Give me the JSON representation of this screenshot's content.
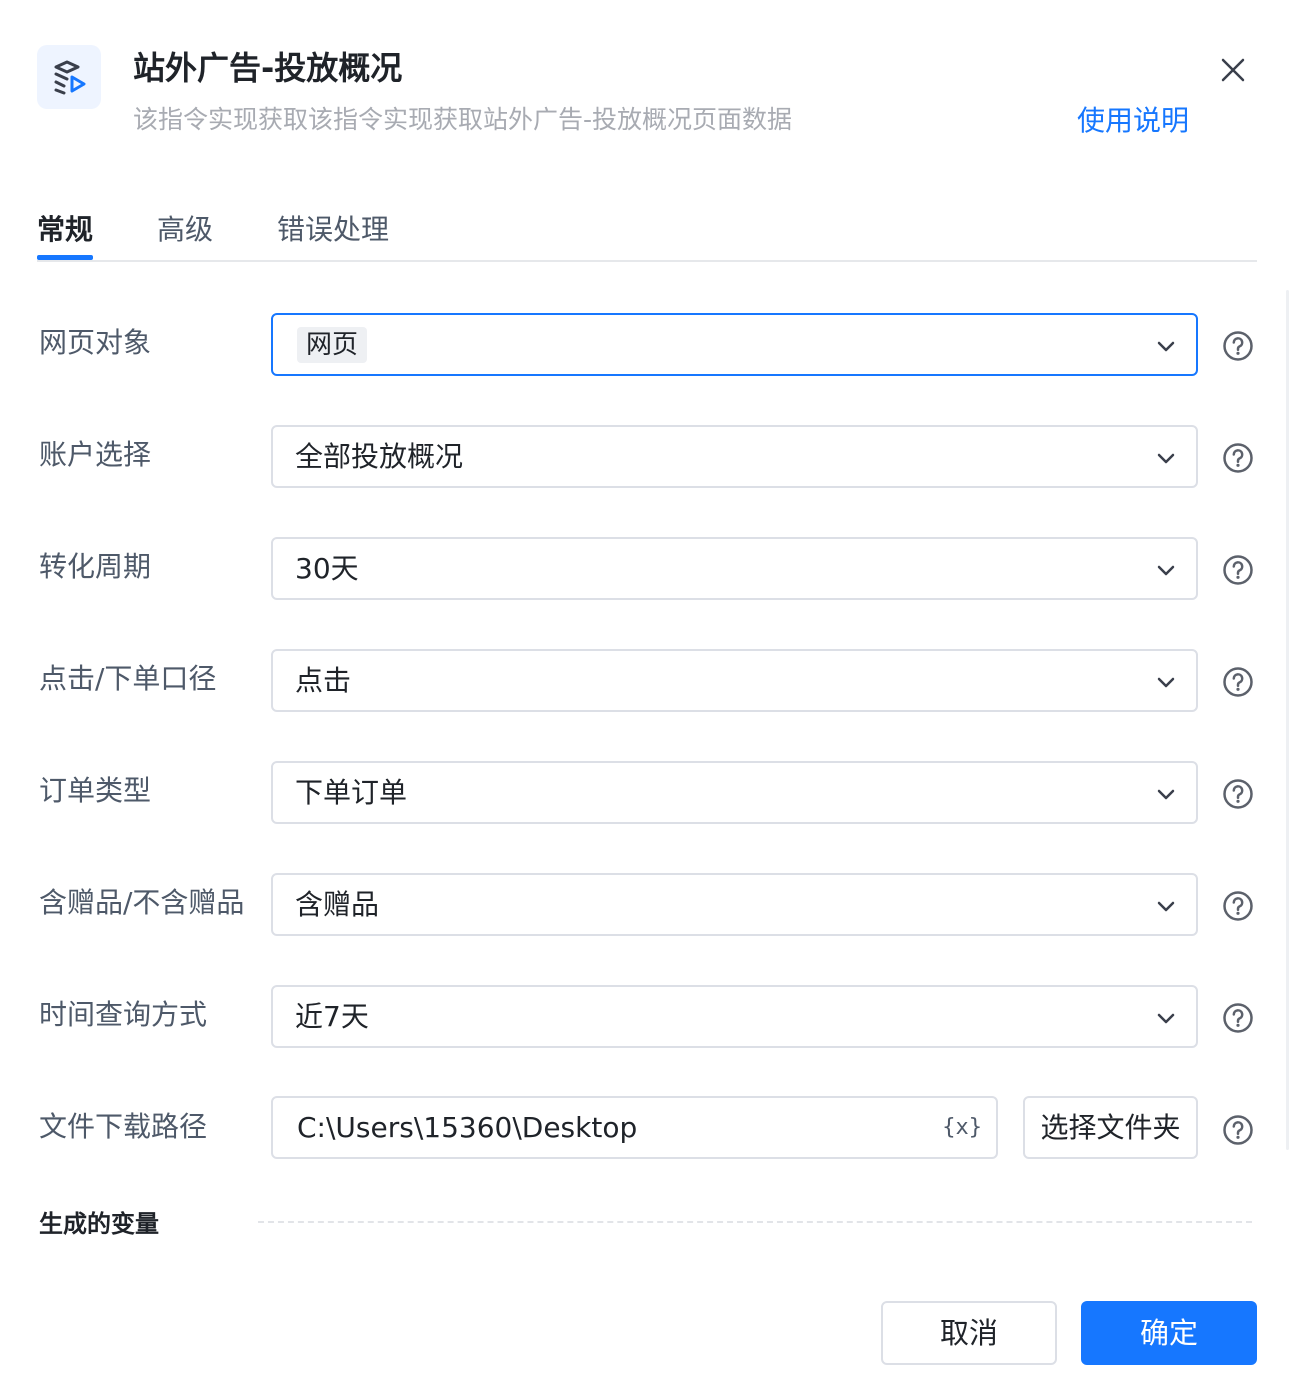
{
  "header": {
    "title": "站外广告-投放概况",
    "subtitle": "该指令实现获取该指令实现获取站外广告-投放概况页面数据",
    "help_link": "使用说明",
    "accent": "#1677ff"
  },
  "tabs": [
    {
      "label": "常规",
      "active": true
    },
    {
      "label": "高级",
      "active": false
    },
    {
      "label": "错误处理",
      "active": false
    }
  ],
  "form": {
    "web_object": {
      "label": "网页对象",
      "value": "网页"
    },
    "account": {
      "label": "账户选择",
      "value": "全部投放概况"
    },
    "conversion_period": {
      "label": "转化周期",
      "value": "30天"
    },
    "click_order": {
      "label": "点击/下单口径",
      "value": "点击"
    },
    "order_type": {
      "label": "订单类型",
      "value": "下单订单"
    },
    "gift": {
      "label": "含赠品/不含赠品",
      "value": "含赠品"
    },
    "time_query": {
      "label": "时间查询方式",
      "value": "近7天"
    },
    "download_path": {
      "label": "文件下载路径",
      "value": "C:\\Users\\15360\\Desktop",
      "var_icon": "{x}",
      "folder_button": "选择文件夹"
    }
  },
  "section": {
    "generated_vars": "生成的变量"
  },
  "footer": {
    "cancel": "取消",
    "confirm": "确定"
  },
  "icons": {
    "app": "stack-play-icon",
    "close": "close-icon",
    "chevron": "chevron-down-icon",
    "help": "question-circle-icon"
  }
}
